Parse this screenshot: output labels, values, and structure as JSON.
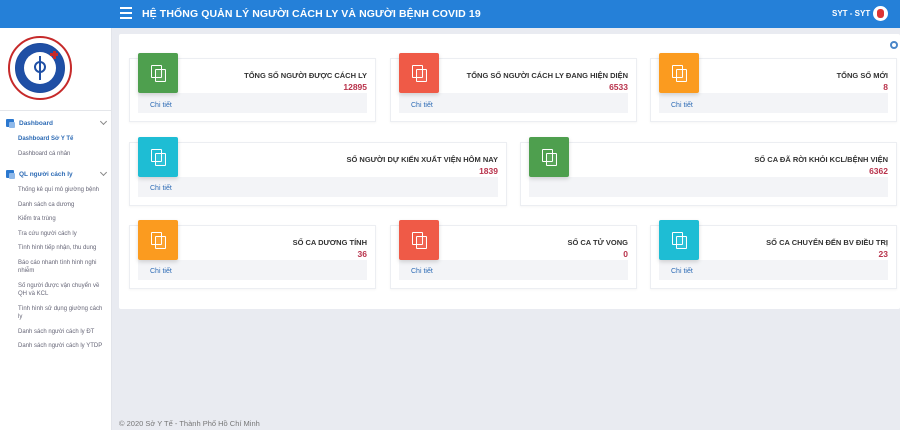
{
  "header": {
    "title": "HỆ THỐNG QUẢN LÝ NGƯỜI CÁCH LY VÀ NGƯỜI BỆNH COVID 19",
    "user": "SYT - SYT"
  },
  "sidebar": {
    "groups": [
      {
        "label": "Dashboard",
        "items": [
          "Dashboard Sở Y Tế",
          "Dashboard cá nhân"
        ],
        "active": 0
      },
      {
        "label": "QL người cách ly",
        "items": [
          "Thống kê quí mô giường bệnh",
          "Danh sách ca dương",
          "Kiểm tra trùng",
          "Tra cứu người cách ly",
          "Tình hình tiếp nhận, thu dung",
          "Báo cáo nhanh tình hình nghi nhiễm",
          "Số người được vận chuyển về QH và KCL",
          "Tình hình sử dụng giường cách ly",
          "Danh sách người cách ly ĐT",
          "Danh sách người cách ly YTDP"
        ]
      }
    ]
  },
  "cards": [
    {
      "title": "TỔNG SỐ NGƯỜI ĐƯỢC CÁCH LY",
      "value": "12895",
      "link": "Chi tiết",
      "color": "#4e9f4e"
    },
    {
      "title": "TỔNG SỐ NGƯỜI CÁCH LY ĐANG HIỆN DIỆN",
      "value": "6533",
      "link": "Chi tiết",
      "color": "#ef5a47"
    },
    {
      "title": "TỔNG SỐ MỚI",
      "value": "8",
      "link": "Chi tiết",
      "color": "#fb9b1f"
    },
    {
      "title": "SỐ NGƯỜI DỰ KIẾN XUẤT VIỆN HÔM NAY",
      "value": "1839",
      "link": "Chi tiết",
      "color": "#1ebdd4"
    },
    {
      "title": "SỐ CA ĐÃ RỜI KHỎI KCL/BỆNH VIỆN",
      "value": "6362",
      "link": "",
      "color": "#4e9f4e"
    },
    {
      "title": "SỐ CA DƯƠNG TÍNH",
      "value": "36",
      "link": "Chi tiết",
      "color": "#fb9b1f"
    },
    {
      "title": "SỐ CA TỬ VONG",
      "value": "0",
      "link": "Chi tiết",
      "color": "#ef5a47"
    },
    {
      "title": "SỐ CA CHUYỂN ĐẾN BV ĐIỀU TRỊ",
      "value": "23",
      "link": "Chi tiết",
      "color": "#1ebdd4"
    }
  ],
  "footer": "© 2020 Sở Y Tế - Thành Phố Hồ Chí Minh",
  "icons": {
    "menu": "hamburger-icon",
    "copy": "copy-icon",
    "settings": "gear-icon"
  }
}
